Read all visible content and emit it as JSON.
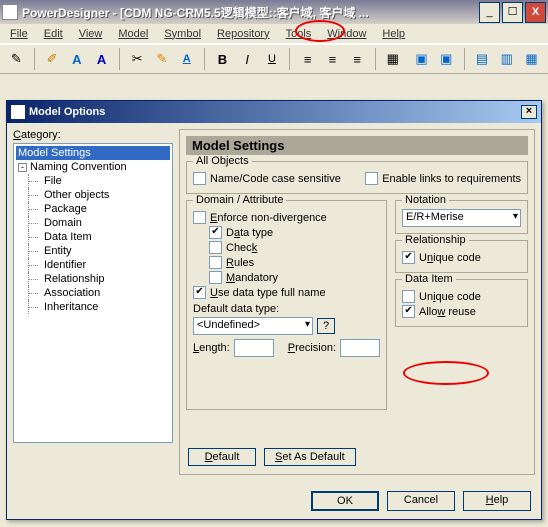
{
  "main": {
    "title": "PowerDesigner - [CDM NG-CRM5.5逻辑模型::客户域, 客户域 ...",
    "menubar": [
      "File",
      "Edit",
      "View",
      "Model",
      "Symbol",
      "Repository",
      "Tools",
      "Window",
      "Help"
    ]
  },
  "dialog": {
    "title": "Model Options",
    "category_label": "Category:",
    "tree": {
      "root": "Model Settings",
      "group": "Naming Convention",
      "items": [
        "File",
        "Other objects",
        "Package",
        "Domain",
        "Data Item",
        "Entity",
        "Identifier",
        "Relationship",
        "Association",
        "Inheritance"
      ]
    },
    "heading": "Model Settings",
    "all_objects": {
      "title": "All Objects",
      "name_code": "Name/Code case sensitive",
      "enable_links": "Enable links to requirements"
    },
    "domain_attr": {
      "title": "Domain / Attribute",
      "enforce": "Enforce non-divergence",
      "data_type": "Data type",
      "check": "Check",
      "rules": "Rules",
      "mandatory": "Mandatory",
      "use_full": "Use data type full name",
      "default_type_label": "Default data type:",
      "default_type_value": "<Undefined>",
      "length": "Length:",
      "precision": "Precision:",
      "q": "?"
    },
    "notation": {
      "title": "Notation",
      "value": "E/R+Merise"
    },
    "relationship": {
      "title": "Relationship",
      "unique": "Unique code"
    },
    "data_item": {
      "title": "Data Item",
      "unique": "Unique code",
      "reuse": "Allow reuse"
    },
    "buttons": {
      "default": "Default",
      "set_default": "Set As Default",
      "ok": "OK",
      "cancel": "Cancel",
      "help": "Help"
    }
  }
}
